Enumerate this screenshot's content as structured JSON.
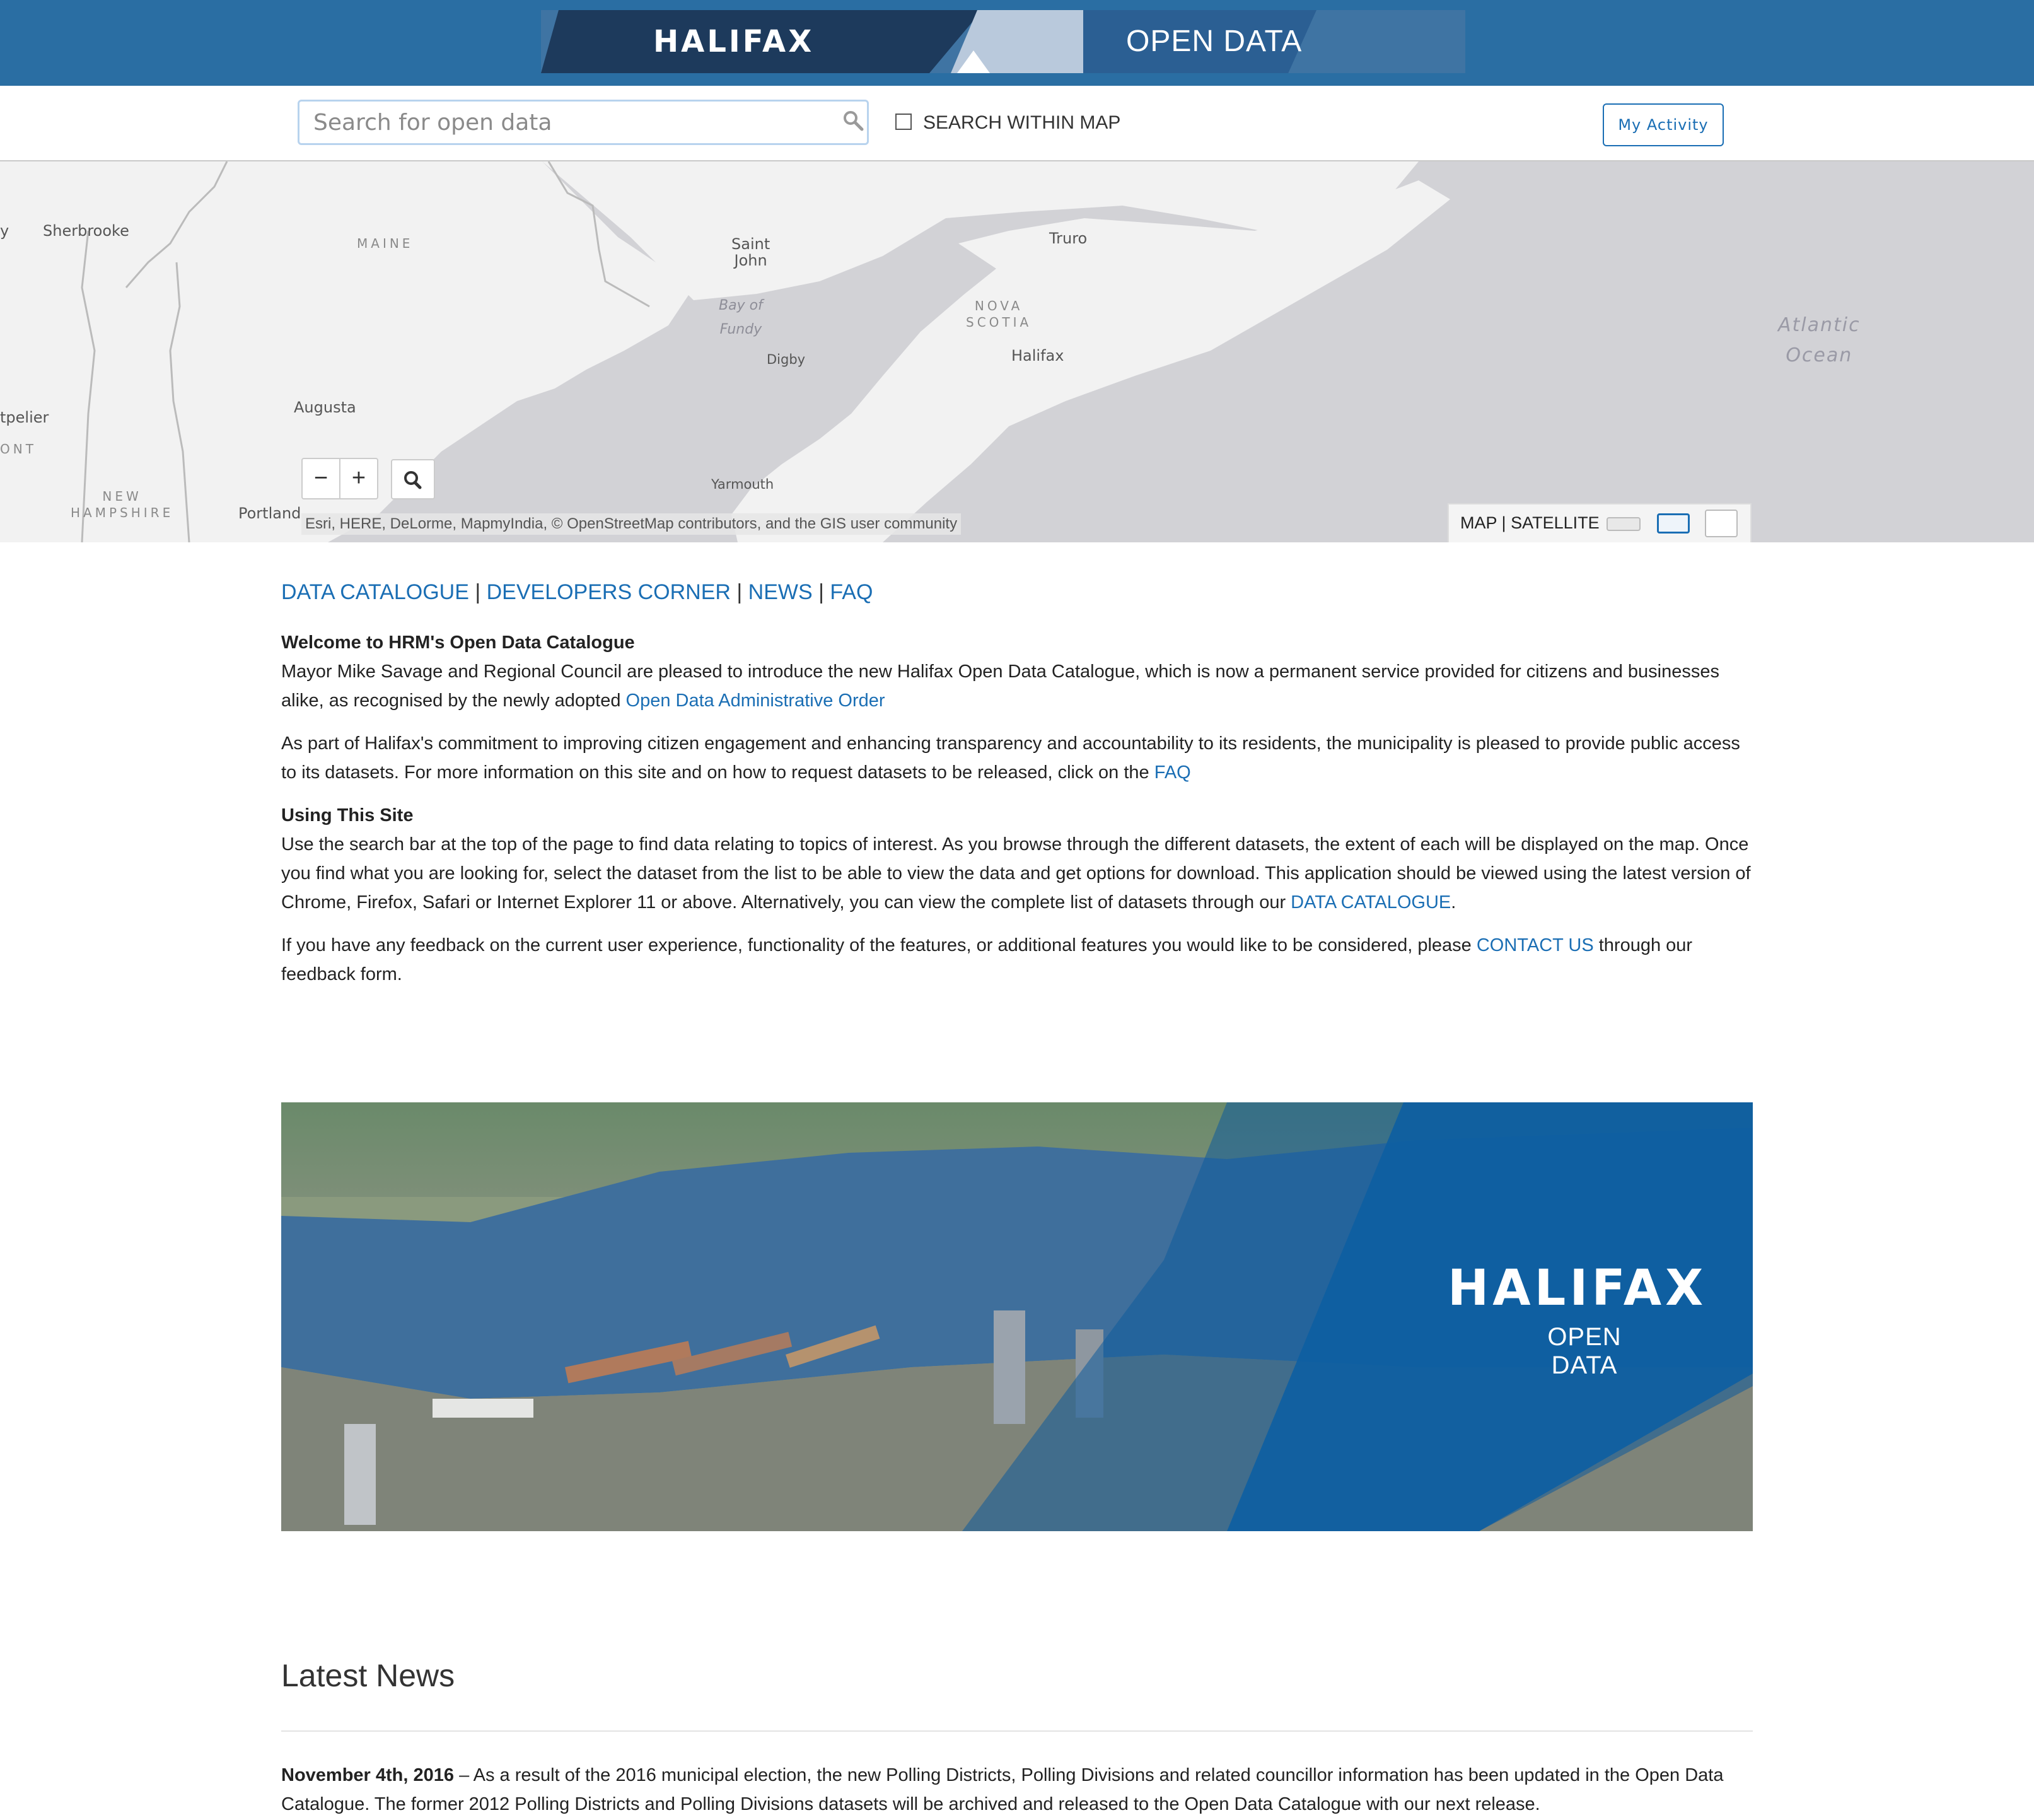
{
  "header": {
    "brand": "HALIFAX",
    "subtitle": "OPEN DATA"
  },
  "search": {
    "placeholder": "Search for open data",
    "within_map_label": "SEARCH WITHIN MAP",
    "activity_button": "My Activity"
  },
  "map": {
    "labels": {
      "sherbrooke": "Sherbrooke",
      "maine": "MAINE",
      "saint_john": "Saint\nJohn",
      "truro": "Truro",
      "bay_of_fundy": "Bay of\nFundy",
      "nova_scotia": "NOVA\nSCOTIA",
      "halifax": "Halifax",
      "digby": "Digby",
      "atlantic_ocean": "Atlantic\nOcean",
      "augusta": "Augusta",
      "montpelier": "tpelier",
      "vermont": "ONT",
      "new_hampshire": "NEW\nHAMPSHIRE",
      "yarmouth": "Yarmouth",
      "portland": "Portland",
      "partial_left": "y"
    },
    "zoom_out": "−",
    "zoom_in": "+",
    "attribution": "Esri, HERE, DeLorme, MapmyIndia, © OpenStreetMap contributors, and the GIS user community",
    "toggle_map": "MAP",
    "toggle_sep": "|",
    "toggle_satellite": "SATELLITE"
  },
  "nav": {
    "catalogue": "DATA CATALOGUE",
    "developers": "DEVELOPERS CORNER",
    "news": "NEWS",
    "faq": "FAQ",
    "sep": " | "
  },
  "content": {
    "welcome_heading": "Welcome to HRM's Open Data Catalogue",
    "welcome_text": "Mayor Mike Savage and Regional Council are pleased to introduce the new Halifax Open Data Catalogue, which is now a permanent service provided for citizens and businesses alike, as recognised by the newly adopted ",
    "welcome_link": "Open Data Administrative Order",
    "commitment_text": "As part of Halifax's commitment to improving citizen engagement and enhancing transparency and accountability to its residents, the municipality is pleased to provide public access to its datasets. For more information on this site and on how to request datasets to be released, click on the ",
    "commitment_link": "FAQ",
    "using_heading": "Using This Site",
    "using_text": "Use the search bar at the top of the page to find data relating to topics of interest. As you browse through the different datasets, the extent of each will be displayed on the map. Once you find what you are looking for, select the dataset from the list to be able to view the data and get options for download. This application should be viewed using the latest version of Chrome, Firefox, Safari or Internet Explorer 11 or above. Alternatively, you can view the complete list of datasets through our ",
    "using_link": "DATA CATALOGUE",
    "using_end": ".",
    "feedback_text": "If you have any feedback on the current user experience, functionality of the features, or additional features you would like to be considered, please ",
    "feedback_link": "CONTACT US",
    "feedback_end": " through our feedback form."
  },
  "photo_banner": {
    "brand": "HALIFAX",
    "subtitle": "OPEN DATA"
  },
  "news": {
    "title": "Latest News",
    "item_date": "November 4th, 2016",
    "item_text": " – As a result of the 2016 municipal election, the new Polling Districts, Polling Divisions and related councillor information has been updated in the Open Data Catalogue. The former 2012 Polling Districts and Polling Divisions datasets will be archived and released to the Open Data Catalogue with our next release."
  },
  "colors": {
    "header_blue": "#2a6ea3",
    "link_blue": "#1a6eb4",
    "map_water": "#d2d2d6",
    "map_land": "#f2f2f2"
  }
}
